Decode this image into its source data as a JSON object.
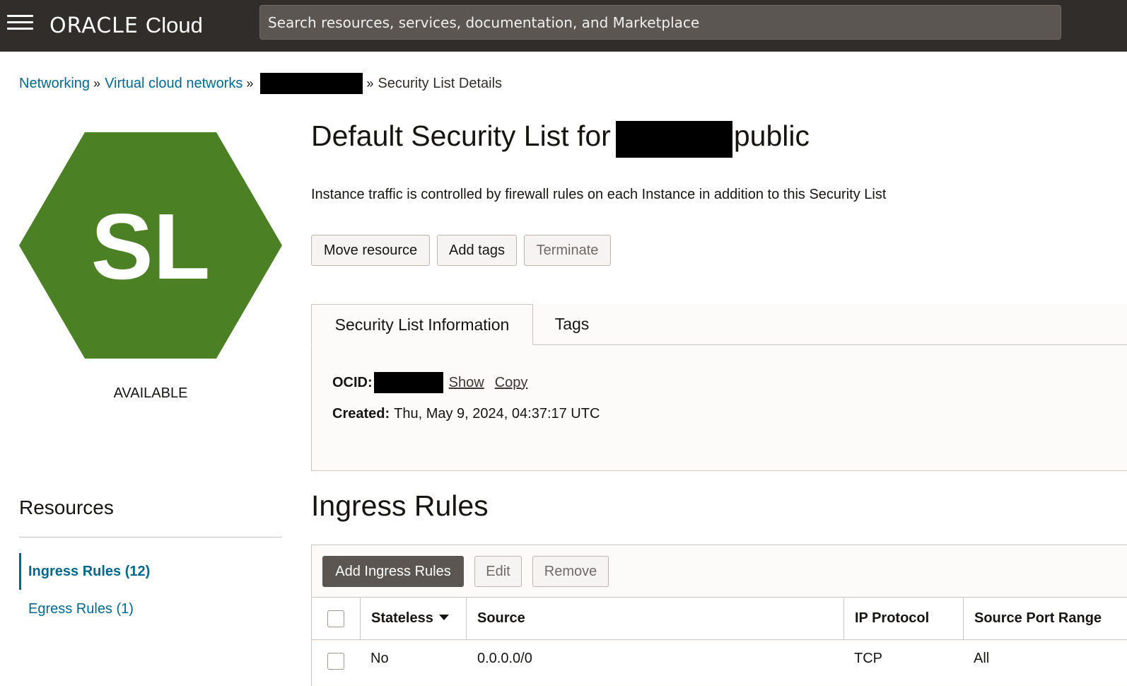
{
  "topbar": {
    "logo_oracle": "ORACLE",
    "logo_cloud": "Cloud",
    "search_placeholder": "Search resources, services, documentation, and Marketplace"
  },
  "breadcrumb": {
    "items": [
      "Networking",
      "Virtual cloud networks"
    ],
    "separator": "»",
    "current": "Security List Details"
  },
  "resource_icon": {
    "abbr": "SL",
    "color": "#4c8024",
    "status": "AVAILABLE"
  },
  "page": {
    "title_prefix": "Default Security List for",
    "title_suffix": "public",
    "description": "Instance traffic is controlled by firewall rules on each Instance in addition to this Security List"
  },
  "actions": {
    "move": "Move resource",
    "tags": "Add tags",
    "terminate": "Terminate"
  },
  "tabs": {
    "info": "Security List Information",
    "tags": "Tags"
  },
  "info": {
    "ocid_label": "OCID:",
    "show": "Show",
    "copy": "Copy",
    "created_label": "Created:",
    "created_value": "Thu, May 9, 2024, 04:37:17 UTC"
  },
  "resources": {
    "title": "Resources",
    "items": [
      {
        "label": "Ingress Rules (12)",
        "active": true
      },
      {
        "label": "Egress Rules (1)",
        "active": false
      }
    ]
  },
  "ingress": {
    "title": "Ingress Rules",
    "add": "Add Ingress Rules",
    "edit": "Edit",
    "remove": "Remove",
    "columns": [
      "Stateless",
      "Source",
      "IP Protocol",
      "Source Port Range"
    ],
    "rows": [
      {
        "stateless": "No",
        "source": "0.0.0.0/0",
        "protocol": "TCP",
        "port_range": "All"
      }
    ]
  },
  "colors": {
    "topbar": "#312d2a",
    "link": "#00688c",
    "primary_button": "#5b5652"
  }
}
